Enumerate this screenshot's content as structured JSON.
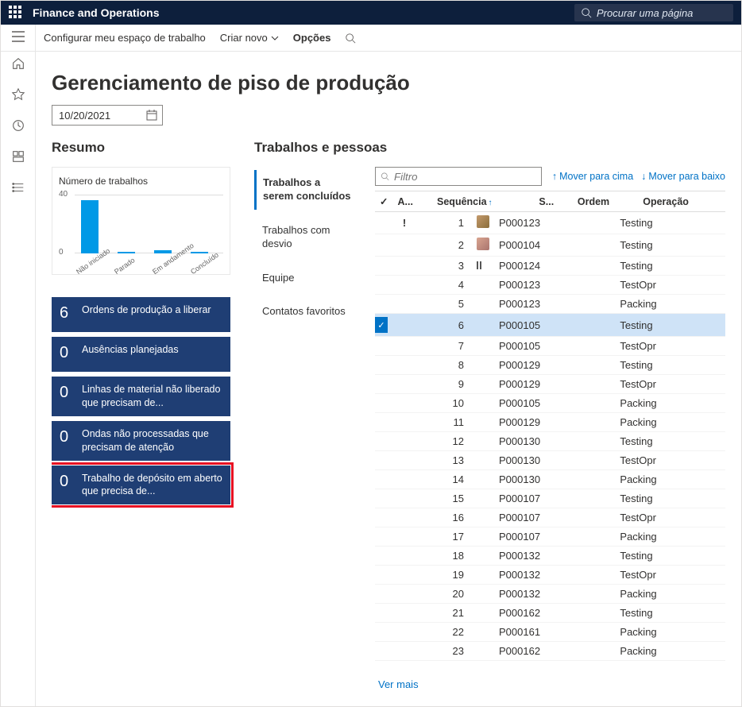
{
  "app_title": "Finance and Operations",
  "search_placeholder": "Procurar uma página",
  "commands": {
    "configure": "Configurar meu espaço de trabalho",
    "create": "Criar novo",
    "options": "Opções"
  },
  "page_title": "Gerenciamento de piso de produção",
  "date_value": "10/20/2021",
  "summary": {
    "heading": "Resumo",
    "chart_title": "Número de trabalhos",
    "tiles": [
      {
        "count": "6",
        "label": "Ordens de produção a liberar"
      },
      {
        "count": "0",
        "label": "Ausências planejadas"
      },
      {
        "count": "0",
        "label": "Linhas de material não liberado que precisam de..."
      },
      {
        "count": "0",
        "label": "Ondas não processadas que precisam de atenção"
      },
      {
        "count": "0",
        "label": "Trabalho de depósito em aberto que precisa de..."
      }
    ]
  },
  "jobs": {
    "heading": "Trabalhos e pessoas",
    "tabs": [
      "Trabalhos a serem concluídos",
      "Trabalhos com desvio",
      "Equipe",
      "Contatos favoritos"
    ],
    "filter_placeholder": "Filtro",
    "move_up": "Mover para cima",
    "move_down": "Mover para baixo",
    "columns": {
      "alert": "A...",
      "seq": "Sequência",
      "status": "S...",
      "order": "Ordem",
      "operation": "Operação"
    },
    "rows": [
      {
        "alert": "!",
        "seq": 1,
        "status": "avatar1",
        "order": "P000123",
        "operation": "Testing"
      },
      {
        "alert": "",
        "seq": 2,
        "status": "avatar2",
        "order": "P000104",
        "operation": "Testing"
      },
      {
        "alert": "",
        "seq": 3,
        "status": "pause",
        "order": "P000124",
        "operation": "Testing"
      },
      {
        "alert": "",
        "seq": 4,
        "status": "",
        "order": "P000123",
        "operation": "TestOpr"
      },
      {
        "alert": "",
        "seq": 5,
        "status": "",
        "order": "P000123",
        "operation": "Packing"
      },
      {
        "alert": "",
        "seq": 6,
        "status": "",
        "order": "P000105",
        "operation": "Testing",
        "selected": true
      },
      {
        "alert": "",
        "seq": 7,
        "status": "",
        "order": "P000105",
        "operation": "TestOpr"
      },
      {
        "alert": "",
        "seq": 8,
        "status": "",
        "order": "P000129",
        "operation": "Testing"
      },
      {
        "alert": "",
        "seq": 9,
        "status": "",
        "order": "P000129",
        "operation": "TestOpr"
      },
      {
        "alert": "",
        "seq": 10,
        "status": "",
        "order": "P000105",
        "operation": "Packing"
      },
      {
        "alert": "",
        "seq": 11,
        "status": "",
        "order": "P000129",
        "operation": "Packing"
      },
      {
        "alert": "",
        "seq": 12,
        "status": "",
        "order": "P000130",
        "operation": "Testing"
      },
      {
        "alert": "",
        "seq": 13,
        "status": "",
        "order": "P000130",
        "operation": "TestOpr"
      },
      {
        "alert": "",
        "seq": 14,
        "status": "",
        "order": "P000130",
        "operation": "Packing"
      },
      {
        "alert": "",
        "seq": 15,
        "status": "",
        "order": "P000107",
        "operation": "Testing"
      },
      {
        "alert": "",
        "seq": 16,
        "status": "",
        "order": "P000107",
        "operation": "TestOpr"
      },
      {
        "alert": "",
        "seq": 17,
        "status": "",
        "order": "P000107",
        "operation": "Packing"
      },
      {
        "alert": "",
        "seq": 18,
        "status": "",
        "order": "P000132",
        "operation": "Testing"
      },
      {
        "alert": "",
        "seq": 19,
        "status": "",
        "order": "P000132",
        "operation": "TestOpr"
      },
      {
        "alert": "",
        "seq": 20,
        "status": "",
        "order": "P000132",
        "operation": "Packing"
      },
      {
        "alert": "",
        "seq": 21,
        "status": "",
        "order": "P000162",
        "operation": "Testing"
      },
      {
        "alert": "",
        "seq": 22,
        "status": "",
        "order": "P000161",
        "operation": "Packing"
      },
      {
        "alert": "",
        "seq": 23,
        "status": "",
        "order": "P000162",
        "operation": "Packing"
      }
    ],
    "see_more": "Ver mais"
  },
  "chart_data": {
    "type": "bar",
    "title": "Número de trabalhos",
    "categories": [
      "Não iniciado",
      "Parado",
      "Em andamento",
      "Concluído"
    ],
    "values": [
      36,
      1,
      2,
      0
    ],
    "ylabel": "",
    "ylim": [
      0,
      40
    ]
  },
  "colors": {
    "navy": "#0d1f3c",
    "tile": "#1f3e74",
    "link": "#0072c6",
    "highlight": "#e81123",
    "select": "#cfe3f7"
  }
}
